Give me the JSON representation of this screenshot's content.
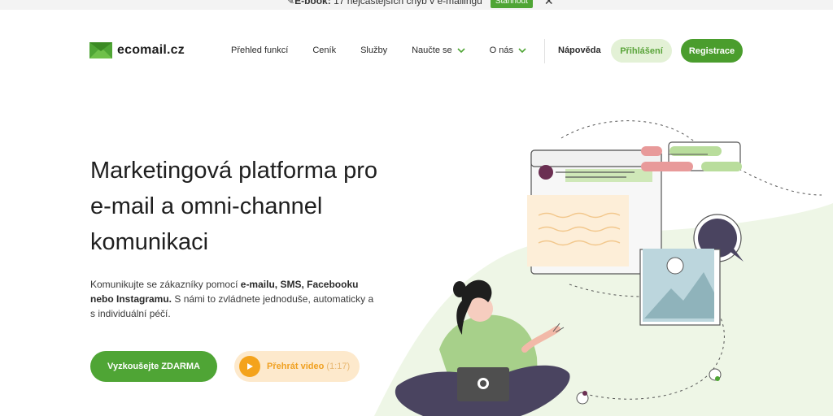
{
  "announcement": {
    "prefix": "E-book:",
    "text": "17 nejčastějších chyb v e-mailingu",
    "button_label": "Stáhnout",
    "close_icon": "close-icon"
  },
  "header": {
    "logo_text": "ecomail.cz",
    "nav": [
      {
        "label": "Přehled funkcí"
      },
      {
        "label": "Ceník"
      },
      {
        "label": "Služby"
      },
      {
        "label": "Naučte se"
      },
      {
        "label": "O nás"
      }
    ],
    "help_label": "Nápověda",
    "login_label": "Přihlášení",
    "register_label": "Registrace"
  },
  "hero": {
    "title": "Marketingová platforma pro e-mail a omni-channel komunikaci",
    "sub_part1": "Komunikujte se zákazníky pomocí ",
    "sub_bold": "e-mailu, SMS, Facebooku nebo Instagramu.",
    "sub_part2": " S námi to zvládnete jednoduše, automaticky a s individuální péčí.",
    "cta_label": "Vyzkoušejte ZDARMA",
    "video_label": "Přehrát video",
    "video_duration": "(1:17)"
  },
  "colors": {
    "brand_green": "#4fa535",
    "brand_green_dark": "#4a9d2d",
    "light_green": "#e3f1d6",
    "video_orange": "#f4a31c",
    "video_bg": "#fde9cc"
  }
}
